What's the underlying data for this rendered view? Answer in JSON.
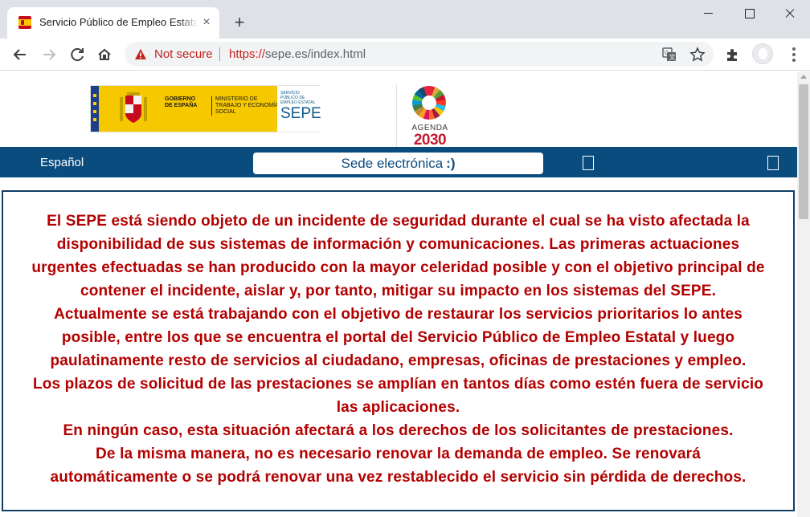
{
  "browser": {
    "tab_title": "Servicio Público de Empleo Estatal",
    "tab_close": "×",
    "new_tab": "+",
    "security_label": "Not secure",
    "url_scheme": "https://",
    "url_rest": "sepe.es/index.html"
  },
  "header": {
    "gov_text": "GOBIERNO DE ESPAÑA",
    "ministry_text": "MINISTERIO DE TRABAJO Y ECONOMÍA SOCIAL",
    "sepe_small": "SERVICIO PÚBLICO DE EMPLEO ESTATAL",
    "sepe_mark": "SEPE",
    "agenda_label": "AGENDA",
    "agenda_year": "2030"
  },
  "navbar": {
    "language": "Español",
    "sede_label": "Sede electrónica",
    "sede_smile": ":)"
  },
  "notice": {
    "lines": [
      "El SEPE está siendo objeto de un incidente de seguridad durante el cual se ha visto afectada la",
      "disponibilidad de sus sistemas de información y comunicaciones. Las primeras actuaciones",
      "urgentes efectuadas se han producido con la mayor celeridad posible y con el objetivo principal de",
      "contener el incidente, aislar y, por tanto, mitigar su impacto en los sistemas del SEPE.",
      "Actualmente se está trabajando con el objetivo de restaurar los servicios prioritarios lo antes",
      "posible, entre los que se encuentra el portal del Servicio Público de Empleo Estatal y luego",
      "paulatinamente resto de servicios al ciudadano, empresas, oficinas de prestaciones y empleo.",
      "Los plazos de solicitud de las prestaciones se amplían en tantos días como estén fuera de servicio",
      "las aplicaciones.",
      "En ningún caso, esta situación afectará a los derechos de los solicitantes de prestaciones.",
      "De la misma manera, no es necesario renovar la demanda de empleo. Se renovará",
      "automáticamente o se podrá renovar una vez restablecido el servicio sin pérdida de derechos."
    ]
  },
  "colors": {
    "navbar": "#0b4c7f",
    "notice_text": "#b30000",
    "notice_border": "#123e66",
    "not_secure": "#c5221f"
  },
  "icons": [
    "back-icon",
    "forward-icon",
    "reload-icon",
    "home-icon",
    "warning-icon",
    "translate-icon",
    "star-icon",
    "extensions-icon",
    "avatar",
    "menu-icon"
  ]
}
